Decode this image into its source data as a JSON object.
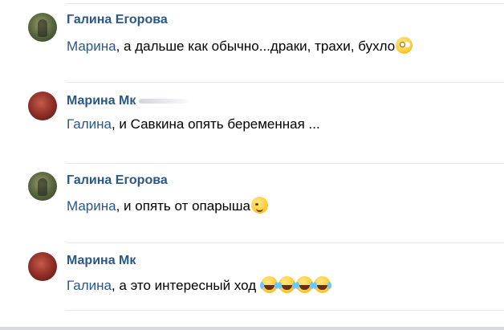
{
  "comments": [
    {
      "author": "Галина Егорова",
      "mention": "Марина",
      "text": ", а дальше как обычно...драки, трахи, бухло",
      "emojis": [
        "rolling-eyes"
      ]
    },
    {
      "author": "Марина Мк",
      "mention": "Галина",
      "text": ", и Савкина опять беременная ...",
      "emojis": []
    },
    {
      "author": "Галина Егорова",
      "mention": "Марина",
      "text": ", и опять от опарыша",
      "emojis": [
        "winking-face"
      ]
    },
    {
      "author": "Марина Мк",
      "mention": "Галина",
      "text": ", а это интересный ход ",
      "emojis": [
        "tears-of-joy",
        "tears-of-joy",
        "tears-of-joy",
        "tears-of-joy"
      ]
    }
  ],
  "colors": {
    "link": "#2a5885",
    "separator": "#e7e8ec",
    "text": "#000000"
  }
}
